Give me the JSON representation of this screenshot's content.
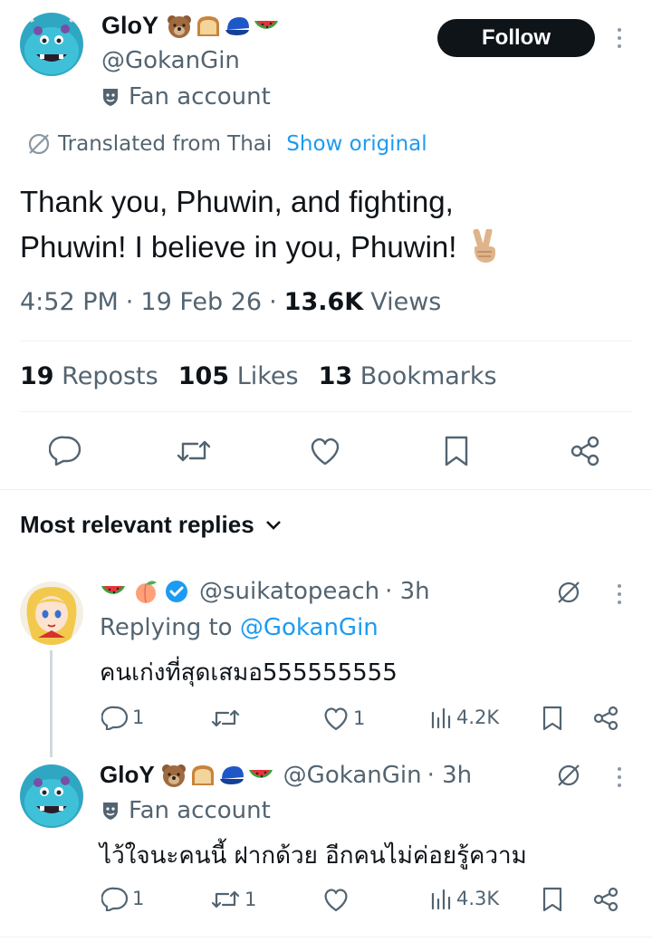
{
  "tweet": {
    "author_name": "GloY",
    "author_handle": "@GokanGin",
    "account_label": "Fan account",
    "follow_label": "Follow",
    "translated_label": "Translated from Thai",
    "show_original_label": "Show original",
    "text_line1": "Thank you, Phuwin, and fighting,",
    "text_line2": "Phuwin! I believe in you, Phuwin!",
    "time": "4:52 PM",
    "date": "19 Feb 26",
    "views_count": "13.6K",
    "views_label": "Views",
    "sep": "·",
    "reposts_count": "19",
    "reposts_label": "Reposts",
    "likes_count": "105",
    "likes_label": "Likes",
    "bookmarks_count": "13",
    "bookmarks_label": "Bookmarks"
  },
  "replies_header": "Most relevant replies",
  "replies": [
    {
      "handle": "@suikatopeach",
      "age": "· 3h",
      "replying_prefix": "Replying to",
      "replying_handle": "@GokanGin",
      "text": "คนเก่งที่สุดเสมอ555555555",
      "reply_count": "1",
      "repost_count": "",
      "like_count": "1",
      "view_count": "4.2K"
    },
    {
      "name": "GloY",
      "handle": "@GokanGin",
      "age": "· 3h",
      "account_label": "Fan account",
      "text": "ไว้ใจนะคนนี้ ฝากด้วย อีกคนไม่ค่อยรู้ความ",
      "reply_count": "1",
      "repost_count": "1",
      "like_count": "",
      "view_count": "4.3K"
    }
  ],
  "colors": {
    "link": "#1d9bf0",
    "muted": "#536471",
    "follow_bg": "#0f1419",
    "verified": "#1d9bf0"
  },
  "icons": [
    "reply-icon",
    "repost-icon",
    "like-icon",
    "bookmark-icon",
    "share-icon",
    "views-icon",
    "translate-icon",
    "fan-account-icon",
    "verified-icon"
  ]
}
